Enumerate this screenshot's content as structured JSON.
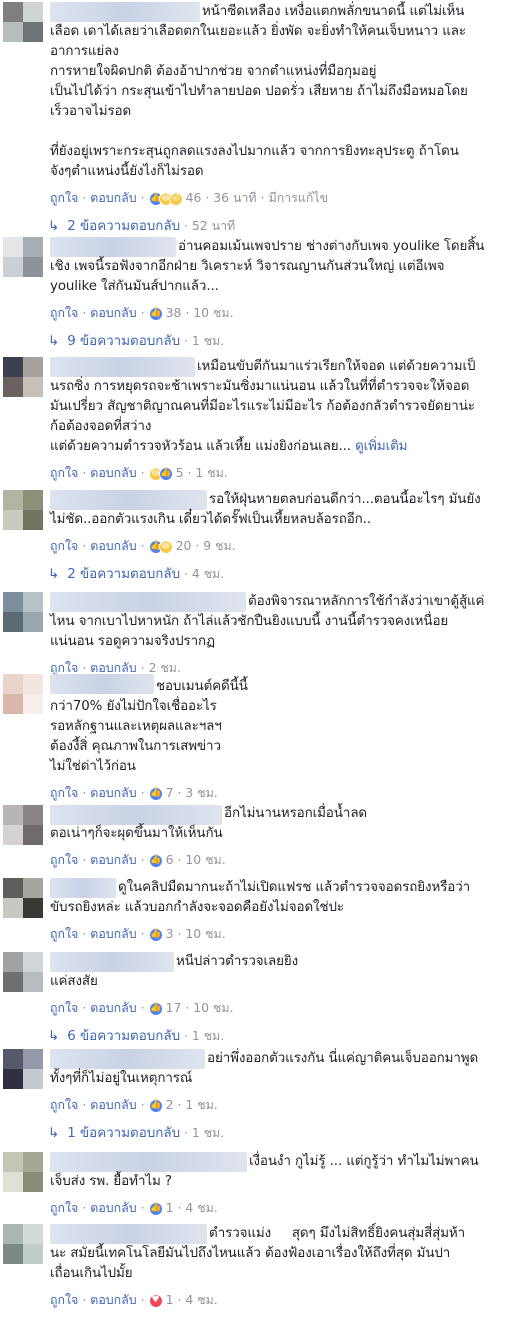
{
  "comments": [
    {
      "text_lines": [
        "หน้าซีดเหลือง เหงื่อแตกพลั่กขนาดนี้ แต่ไม่เห็น",
        "เลือด เดาได้เลยว่าเลือดตกในเยอะแล้ว ยิ่งพัด จะยิ่งทำให้คนเจ็บหนาว และ",
        "อาการแย่ลง",
        "การหายใจผิดปกติ ต้องอ้าปากช่วย จากตำแหน่งที่มือกุมอยู่",
        "เป็นไปได้ว่า กระสุนเข้าไปทำลายปอด ปอดรั่ว เสียหาย ถ้าไม่ถึงมือหมอโดย",
        "เร็วอาจไม่รอด",
        "",
        "ที่ยังอยู่เพราะกระสุนถูกลดแรงลงไปมากแล้ว จากการยิงทะลุประตู ถ้าโดน",
        "จังๆตำแหน่งนี้ยังไงก็ไม่รอด"
      ],
      "like": "ถูกใจ",
      "reply": "ตอบกลับ",
      "reactions": [
        "like",
        "haha",
        "wow"
      ],
      "reaction_count": "46",
      "time": "36 นาที",
      "edited": "มีการแก้ไข",
      "replies_label": "2 ข้อความตอบกลับ",
      "replies_time": "52 นาที"
    },
    {
      "text_lines": [
        "อ่านคอมเม้นเพจปราย ช่างต่างกับเพจ youlike โดยสิ้น",
        "เชิง เพจนี้รอฟังจากอีกฝ่าย วิเคราะห์ วิจารณญานกันส่วนใหญ่ แต่อีเพจ",
        "youlike ใส่กันมันส์ปากแล้ว..."
      ],
      "like": "ถูกใจ",
      "reply": "ตอบกลับ",
      "reactions": [
        "like"
      ],
      "reaction_count": "38",
      "time": "10 ชม.",
      "replies_label": "9 ข้อความตอบกลับ",
      "replies_time": "1 ชม."
    },
    {
      "text_lines": [
        "เหมือนขับตีกันมาแร่วเรียกให้จอด แต่ด้วยความเป็",
        "นรถซิ่ง การหยุดรถจะช้าเพราะมันซิ่งมาแน่นอน แล้วในที่ที่ตำรวจจะให้จอด",
        "มันเปรี่ยว สัญชาติญาณคนที่มีอะไรแระไม่มีอะไร ก้อต้องกลัวตำรวจยัดยาน่ะ",
        "ก้อต้องจอดที่สว่าง",
        "แต่ด้วยความตำรวจหัวร้อน แล้วเหี้ย แม่งยิงก่อนเลย..."
      ],
      "see_more": "ดูเพิ่มเติม",
      "like": "ถูกใจ",
      "reply": "ตอบกลับ",
      "reactions": [
        "haha",
        "like"
      ],
      "reaction_count": "5",
      "time": "1 ชม."
    },
    {
      "text_lines": [
        "รอให้ฝุ่นหายตลบก่อนดีกว่า...ตอนนี้อะไรๆ มันยัง",
        "ไม่ชัด..ออกตัวแรงเกิน เดี๋ยวได้ดรั๊ฟเป็นเหี้ยหลบล้อรถอีก.."
      ],
      "like": "ถูกใจ",
      "reply": "ตอบกลับ",
      "reactions": [
        "like",
        "haha"
      ],
      "reaction_count": "20",
      "time": "9 ชม.",
      "replies_label": "2 ข้อความตอบกลับ",
      "replies_time": "4 ชม."
    },
    {
      "text_lines": [
        "ต้องพิจารณาหลักการใช้กำลังว่าเขาตู้สู้แค่",
        "ไหน จากเบาไปหาหนัก ถ้าไล่แล้วชักปืนยิงแบบนี้ งานนี้ตำรวจคงเหนื่อย",
        "แน่นอน รอดูความจริงปรากฏ"
      ],
      "like": "ถูกใจ",
      "reply": "ตอบกลับ",
      "reactions": [],
      "reaction_count": "",
      "time": "2 ชม."
    },
    {
      "text_lines": [
        "ชอบเมนต์คดีนี้นี้",
        "กว่า70% ยังไม่ปักใจเชื่ออะไร",
        "รอหลักฐานและเหตุผลและฯลฯ",
        "ต้องงี้สิ่ คุณภาพในการเสพข่าว",
        "ไม่ใช่ด่าไว้ก่อน"
      ],
      "like": "ถูกใจ",
      "reply": "ตอบกลับ",
      "reactions": [
        "like"
      ],
      "reaction_count": "7",
      "time": "3 ชม."
    },
    {
      "text_lines": [
        "อีกไม่นานหรอกเมื่อน้ำลด",
        "ตอเน่าๆก็จะผุดขึ้นมาให้เห็นกัน"
      ],
      "like": "ถูกใจ",
      "reply": "ตอบกลับ",
      "reactions": [
        "like"
      ],
      "reaction_count": "6",
      "time": "10 ชม."
    },
    {
      "text_lines": [
        "ดูในคลิปมืดมากนะถ้าไม่เปิดแฟรช แล้วตำรวจจอดรถยิงหรือว่า",
        "ขับรถยิงหล่ะ แล้วบอกกำลังจะจอดคือยังไม่จอดใช่ปะ"
      ],
      "like": "ถูกใจ",
      "reply": "ตอบกลับ",
      "reactions": [
        "like"
      ],
      "reaction_count": "3",
      "time": "10 ชม."
    },
    {
      "text_lines": [
        "หนีปล่าวตำรวจเลยยิง",
        "แค่สงสัย"
      ],
      "like": "ถูกใจ",
      "reply": "ตอบกลับ",
      "reactions": [
        "like"
      ],
      "reaction_count": "17",
      "time": "10 ชม.",
      "replies_label": "6 ข้อความตอบกลับ",
      "replies_time": "1 ชม."
    },
    {
      "text_lines": [
        "อย่าพึ่งออกตัวแรงกัน นี่แค่ญาติคนเจ็บออกมาพูด",
        "ทั้งๆที่ก็ไม่อยู่ในเหตุการณ์"
      ],
      "like": "ถูกใจ",
      "reply": "ตอบกลับ",
      "reactions": [
        "like"
      ],
      "reaction_count": "2",
      "time": "1 ชม.",
      "replies_label": "1 ข้อความตอบกลับ",
      "replies_time": "1 ชม."
    },
    {
      "text_lines": [
        "เงื่อนงำ กูไม่รู้ ... แต่กูรู้ว่า ทำไมไม่พาคน",
        "เจ็บส่ง รพ. ยื้อทำไม ?"
      ],
      "like": "ถูกใจ",
      "reply": "ตอบกลับ",
      "reactions": [
        "like"
      ],
      "reaction_count": "1",
      "time": "4 ชม."
    },
    {
      "text_lines": [
        "ตำรวจแม่ง     สุดๆ มึงไม่สิทธิ์ยิงคนสุ่มสี่สุ่มห้า",
        "นะ สมัยนี้เทคโนโลยีมันไปถึงไหนแล้ว ต้องฟ้องเอาเรื่องให้ถึงที่สุด มันปา",
        "เถื่อนเกินไปมั้ย"
      ],
      "like": "ถูกใจ",
      "reply": "ตอบกลับ",
      "reactions": [
        "love"
      ],
      "reaction_count": "1",
      "time": "4 ชม."
    }
  ],
  "colors": {
    "link": "#4267b2",
    "meta": "#90949c",
    "text": "#1d2129",
    "like": "#4c84f6",
    "love": "#f0465b",
    "haha": "#f7c842"
  },
  "icons": {
    "reply_arrow": "reply-arrow-icon",
    "reactions": [
      "like-reaction-icon",
      "haha-reaction-icon",
      "wow-reaction-icon",
      "love-reaction-icon"
    ]
  }
}
